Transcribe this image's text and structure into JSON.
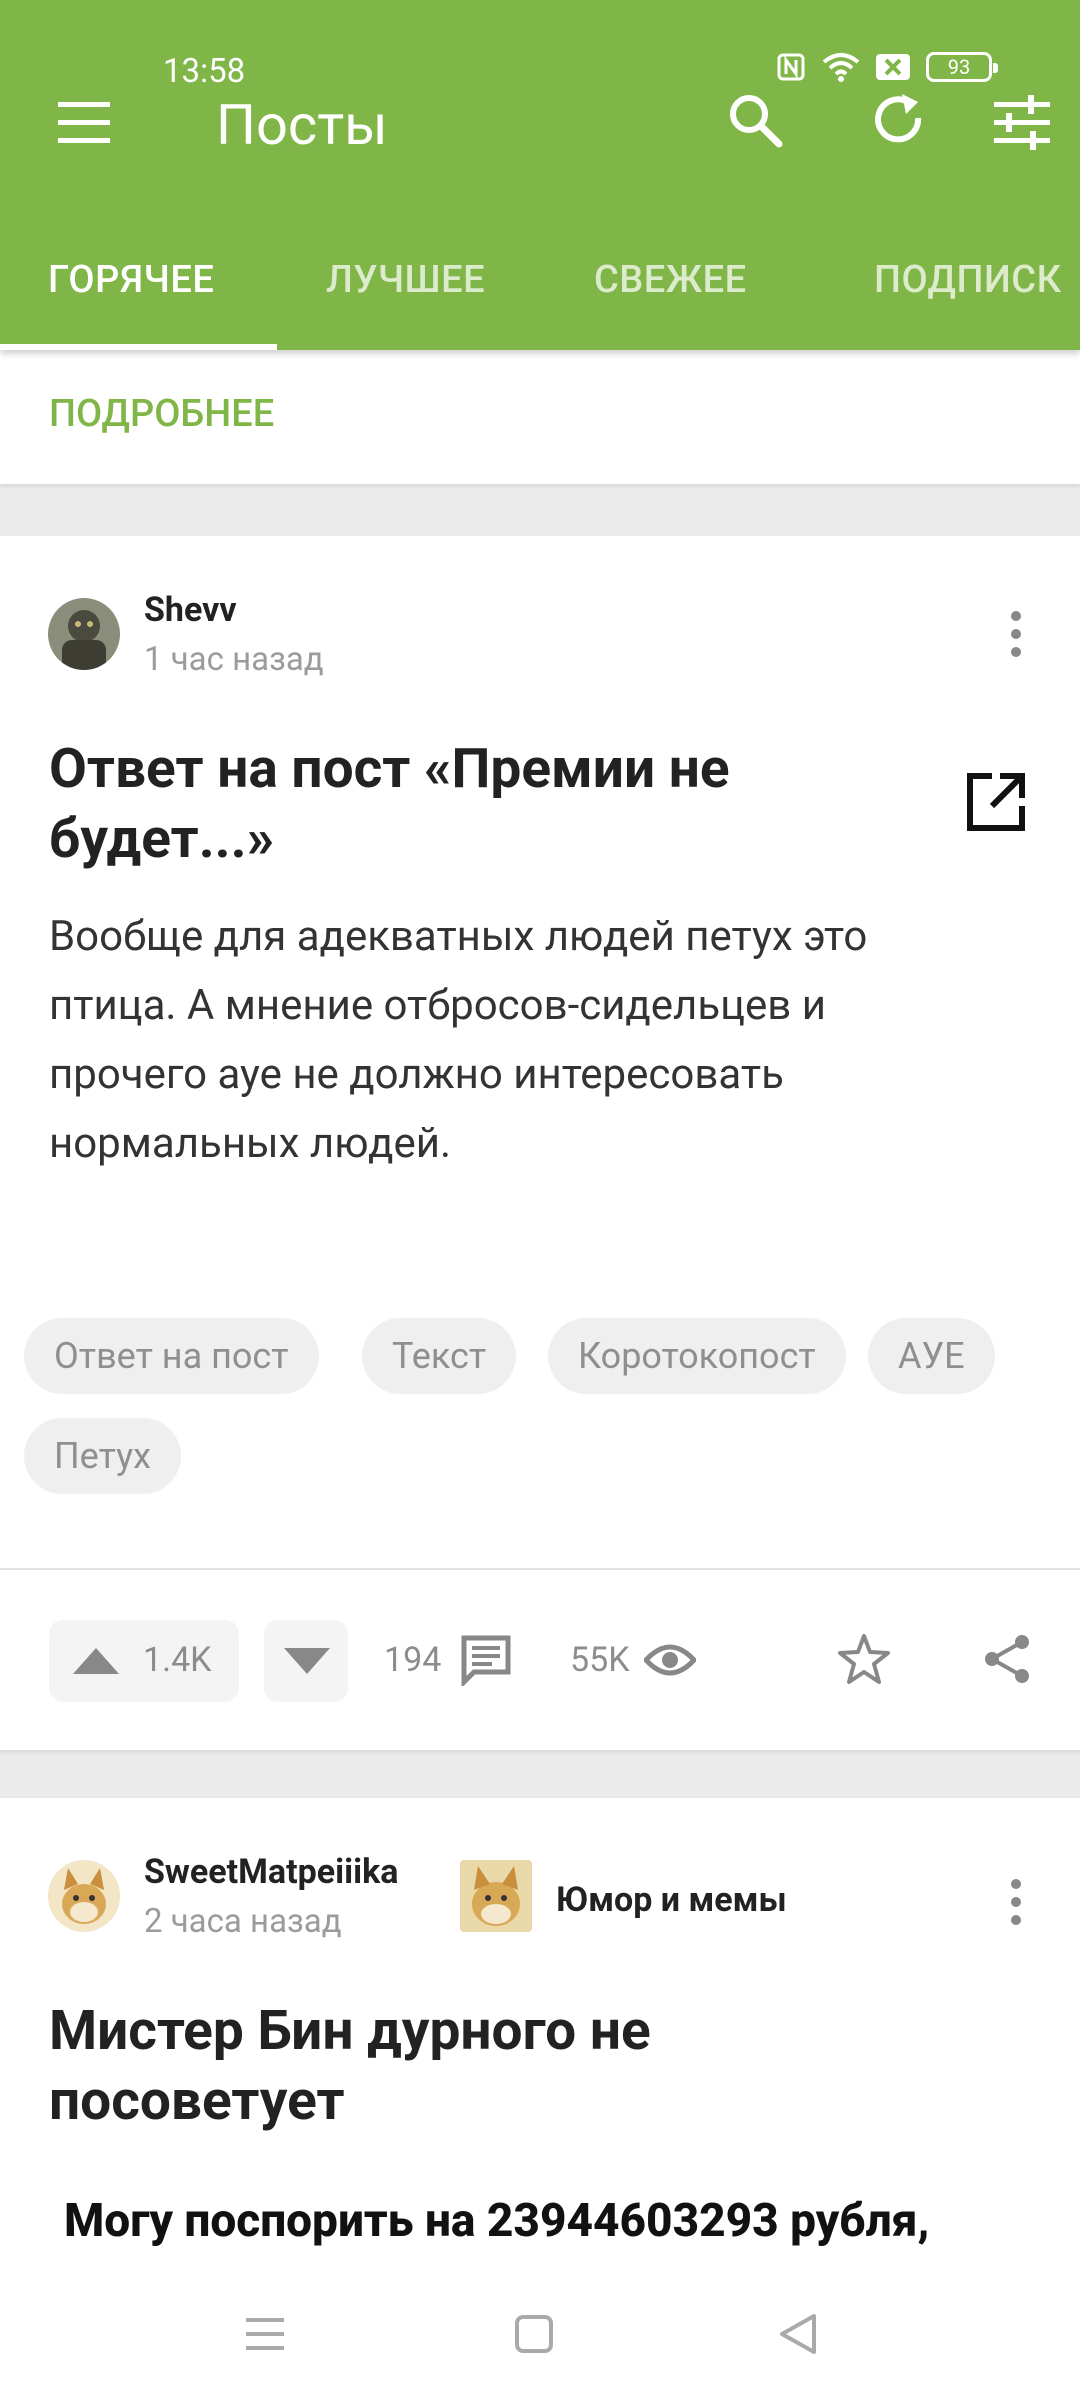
{
  "status_bar": {
    "time": "13:58",
    "battery": "93"
  },
  "header": {
    "title": "Посты"
  },
  "tabs": [
    {
      "label": "ГОРЯЧЕЕ",
      "active": true
    },
    {
      "label": "ЛУЧШЕЕ"
    },
    {
      "label": "СВЕЖЕЕ"
    },
    {
      "label": "ПОДПИСК"
    }
  ],
  "more_card": {
    "link": "ПОДРОБНЕЕ"
  },
  "posts": [
    {
      "author": "Shevv",
      "time": "1 час назад",
      "title_line1": "Ответ на пост «Премии не",
      "title_line2": "будет...»",
      "text_lines": [
        "Вообще для адекватных людей петух это",
        "птица. А мнение отбросов-сидельцев и",
        "прочего ауе не должно интересовать",
        "нормальных людей."
      ],
      "tags": [
        "Ответ на пост",
        "Текст",
        "Коротокопост",
        "АУЕ",
        "Петух"
      ],
      "rating": "1.4K",
      "comments": "194",
      "views": "55K"
    },
    {
      "author": "SweetMatpeiiika",
      "time": "2 часа назад",
      "community": "Юмор и мемы",
      "title_line1": "Мистер Бин дурного не",
      "title_line2": "посоветует",
      "image_caption": "Могу поспорить на 23944603293 рубля,"
    }
  ],
  "colors": {
    "accent": "#80b647",
    "tag_bg": "#efefef",
    "text": "#222222",
    "muted": "#9b9b9b"
  }
}
